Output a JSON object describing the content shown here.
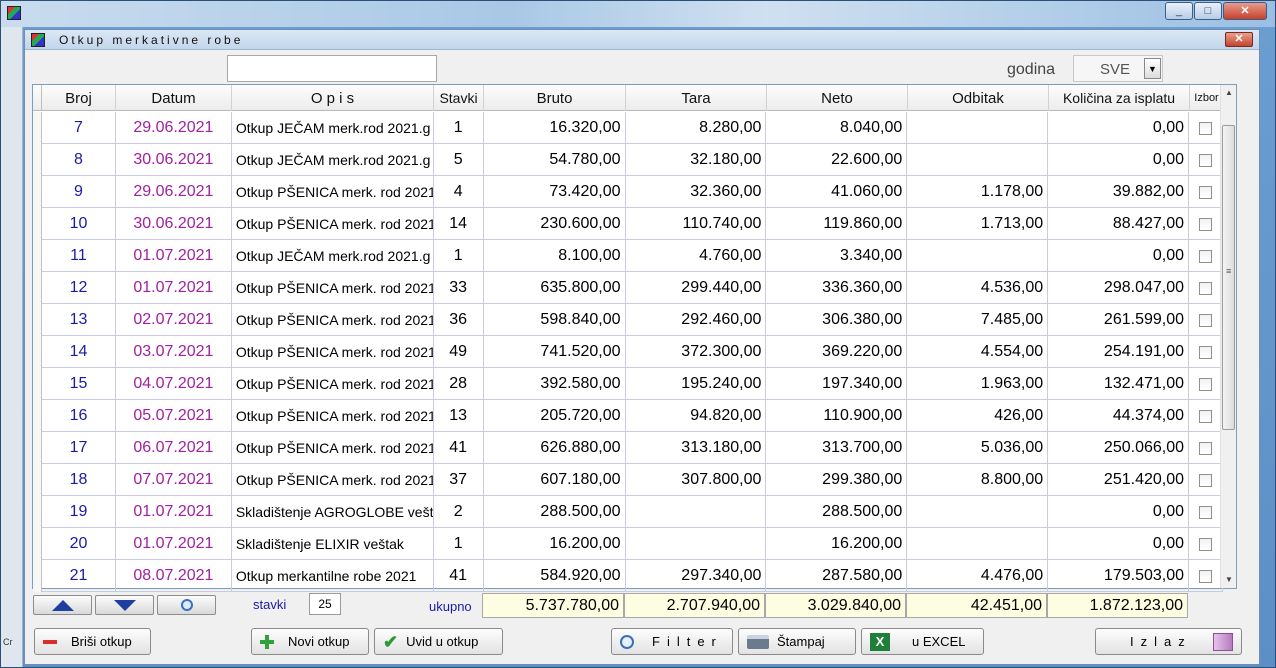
{
  "outer": {
    "controls": {
      "minimize": "_",
      "maximize": "□",
      "close": "✕"
    },
    "side_label": "Cr"
  },
  "window": {
    "title": "Otkup merkativne robe",
    "close": "✕"
  },
  "filter": {
    "search_value": "",
    "year_label": "godina",
    "year_value": "SVE"
  },
  "columns": {
    "broj": "Broj",
    "datum": "Datum",
    "opis": "O p i s",
    "stavki": "Stavki",
    "bruto": "Bruto",
    "tara": "Tara",
    "neto": "Neto",
    "odbitak": "Odbitak",
    "kolicina": "Količina za isplatu",
    "izbor": "Izbor"
  },
  "rows": [
    {
      "broj": "7",
      "datum": "29.06.2021",
      "opis": "Otkup JEČAM merk.rod 2021.g",
      "stavki": "1",
      "bruto": "16.320,00",
      "tara": "8.280,00",
      "neto": "8.040,00",
      "odbitak": "",
      "kolicina": "0,00"
    },
    {
      "broj": "8",
      "datum": "30.06.2021",
      "opis": "Otkup JEČAM merk.rod 2021.g",
      "stavki": "5",
      "bruto": "54.780,00",
      "tara": "32.180,00",
      "neto": "22.600,00",
      "odbitak": "",
      "kolicina": "0,00"
    },
    {
      "broj": "9",
      "datum": "29.06.2021",
      "opis": "Otkup PŠENICA merk. rod 2021",
      "stavki": "4",
      "bruto": "73.420,00",
      "tara": "32.360,00",
      "neto": "41.060,00",
      "odbitak": "1.178,00",
      "kolicina": "39.882,00"
    },
    {
      "broj": "10",
      "datum": "30.06.2021",
      "opis": "Otkup PŠENICA merk. rod 2021",
      "stavki": "14",
      "bruto": "230.600,00",
      "tara": "110.740,00",
      "neto": "119.860,00",
      "odbitak": "1.713,00",
      "kolicina": "88.427,00"
    },
    {
      "broj": "11",
      "datum": "01.07.2021",
      "opis": "Otkup JEČAM merk.rod 2021.g",
      "stavki": "1",
      "bruto": "8.100,00",
      "tara": "4.760,00",
      "neto": "3.340,00",
      "odbitak": "",
      "kolicina": "0,00"
    },
    {
      "broj": "12",
      "datum": "01.07.2021",
      "opis": "Otkup PŠENICA merk. rod 2021",
      "stavki": "33",
      "bruto": "635.800,00",
      "tara": "299.440,00",
      "neto": "336.360,00",
      "odbitak": "4.536,00",
      "kolicina": "298.047,00"
    },
    {
      "broj": "13",
      "datum": "02.07.2021",
      "opis": "Otkup PŠENICA merk. rod 2021",
      "stavki": "36",
      "bruto": "598.840,00",
      "tara": "292.460,00",
      "neto": "306.380,00",
      "odbitak": "7.485,00",
      "kolicina": "261.599,00"
    },
    {
      "broj": "14",
      "datum": "03.07.2021",
      "opis": "Otkup PŠENICA merk. rod 2021",
      "stavki": "49",
      "bruto": "741.520,00",
      "tara": "372.300,00",
      "neto": "369.220,00",
      "odbitak": "4.554,00",
      "kolicina": "254.191,00"
    },
    {
      "broj": "15",
      "datum": "04.07.2021",
      "opis": "Otkup PŠENICA merk. rod 2021",
      "stavki": "28",
      "bruto": "392.580,00",
      "tara": "195.240,00",
      "neto": "197.340,00",
      "odbitak": "1.963,00",
      "kolicina": "132.471,00"
    },
    {
      "broj": "16",
      "datum": "05.07.2021",
      "opis": "Otkup PŠENICA merk. rod 2021",
      "stavki": "13",
      "bruto": "205.720,00",
      "tara": "94.820,00",
      "neto": "110.900,00",
      "odbitak": "426,00",
      "kolicina": "44.374,00"
    },
    {
      "broj": "17",
      "datum": "06.07.2021",
      "opis": "Otkup PŠENICA merk. rod 2021",
      "stavki": "41",
      "bruto": "626.880,00",
      "tara": "313.180,00",
      "neto": "313.700,00",
      "odbitak": "5.036,00",
      "kolicina": "250.066,00"
    },
    {
      "broj": "18",
      "datum": "07.07.2021",
      "opis": "Otkup PŠENICA merk. rod 2021",
      "stavki": "37",
      "bruto": "607.180,00",
      "tara": "307.800,00",
      "neto": "299.380,00",
      "odbitak": "8.800,00",
      "kolicina": "251.420,00"
    },
    {
      "broj": "19",
      "datum": "01.07.2021",
      "opis": "Skladištenje AGROGLOBE veštak",
      "stavki": "2",
      "bruto": "288.500,00",
      "tara": "",
      "neto": "288.500,00",
      "odbitak": "",
      "kolicina": "0,00"
    },
    {
      "broj": "20",
      "datum": "01.07.2021",
      "opis": "Skladištenje ELIXIR veštak",
      "stavki": "1",
      "bruto": "16.200,00",
      "tara": "",
      "neto": "16.200,00",
      "odbitak": "",
      "kolicina": "0,00"
    },
    {
      "broj": "21",
      "datum": "08.07.2021",
      "opis": "Otkup merkantilne robe 2021",
      "stavki": "41",
      "bruto": "584.920,00",
      "tara": "297.340,00",
      "neto": "287.580,00",
      "odbitak": "4.476,00",
      "kolicina": "179.503,00"
    }
  ],
  "footer": {
    "stavki_label": "stavki",
    "stavki_value": "25",
    "ukupno_label": "ukupno",
    "totals": {
      "bruto": "5.737.780,00",
      "tara": "2.707.940,00",
      "neto": "3.029.840,00",
      "odbitak": "42.451,00",
      "kolicina": "1.872.123,00"
    }
  },
  "buttons": {
    "brisi": "Briši otkup",
    "novi": "Novi otkup",
    "uvid": "Uvid u  otkup",
    "filter": "Filter",
    "stampaj": "Štampaj",
    "excel": "u EXCEL",
    "izlaz": "Izlaz"
  },
  "colors": {
    "broj": "#1a1aa8",
    "datum": "#a0209f",
    "totals_bg": "#fdfde1"
  }
}
